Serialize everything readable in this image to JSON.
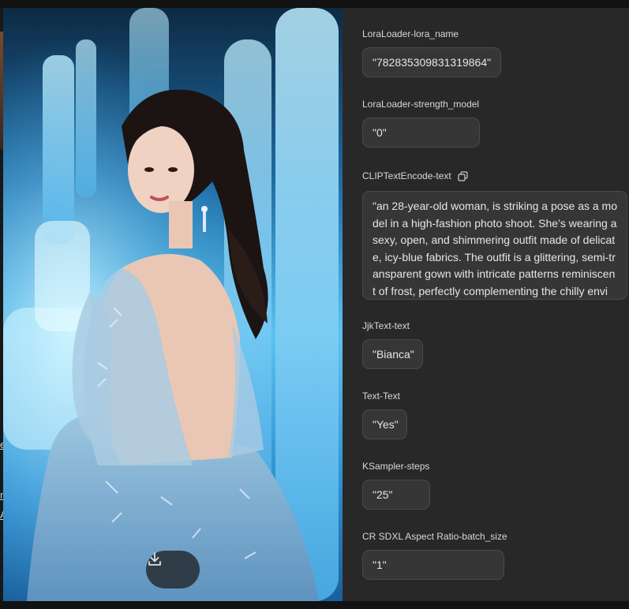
{
  "image": {
    "download_icon": "download-icon"
  },
  "panel": {
    "fields": {
      "lora_name": {
        "label": "LoraLoader-lora_name",
        "value": "\"782835309831319864\""
      },
      "strength_model": {
        "label": "LoraLoader-strength_model",
        "value": "\"0\""
      },
      "clip_text": {
        "label": "CLIPTextEncode-text",
        "copy_icon": "copy-icon",
        "value": "\"an 28-year-old woman, is striking a pose as a model in a high-fashion photo shoot. She’s wearing a sexy, open, and shimmering outfit made of delicate, icy-blue fabrics. The outfit is a glittering, semi-transparent gown with intricate patterns reminiscent of frost, perfectly complementing the chilly envi"
      },
      "jjk_text": {
        "label": "JjkText-text",
        "value": "\"Bianca\""
      },
      "text_text": {
        "label": "Text-Text",
        "value": "\"Yes\""
      },
      "ksampler_steps": {
        "label": "KSampler-steps",
        "value": "\"25\""
      },
      "batch_size": {
        "label": "CR SDXL Aspect Ratio-batch_size",
        "value": "\"1\""
      }
    }
  },
  "left_edge": {
    "fragments": [
      "e",
      "n",
      "A"
    ]
  }
}
